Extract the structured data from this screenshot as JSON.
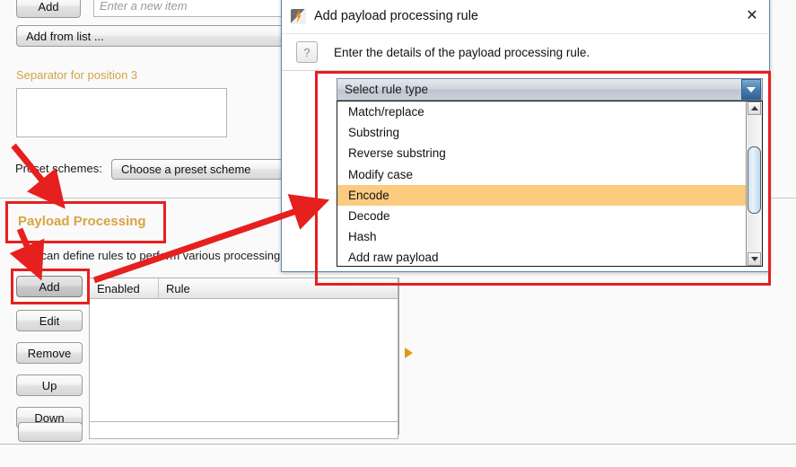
{
  "background": {
    "add_button": "Add",
    "new_item_placeholder": "Enter a new item",
    "add_from_list": "Add from list ...",
    "separator_label": "Separator for position 3",
    "separator_value": "",
    "preset_label": "Preset schemes:",
    "preset_value": "Choose a preset scheme",
    "payload_processing_title": "Payload Processing",
    "payload_processing_desc": "You can define rules to perform various processing",
    "buttons": [
      "Add",
      "Edit",
      "Remove",
      "Up",
      "Down"
    ],
    "table": {
      "columns": [
        "Enabled",
        "Rule"
      ],
      "rows": []
    },
    "bottom_button": "",
    "accent_heading_color": "#d9a441",
    "accent_label_color": "#d3a34a"
  },
  "dialog": {
    "title": "Add payload processing rule",
    "icon": "burp-bolt-icon",
    "close_label": "✕",
    "help_badge": "?",
    "instruction": "Enter the details of the payload processing rule.",
    "combo": {
      "selected": "Select rule type",
      "options": [
        "Match/replace",
        "Substring",
        "Reverse substring",
        "Modify case",
        "Encode",
        "Decode",
        "Hash",
        "Add raw payload"
      ],
      "highlighted": "Encode",
      "highlight_color": "#fbcc7f"
    }
  },
  "annotations": {
    "color": "#e5201f",
    "boxes": [
      "dropdown-list",
      "payload-processing-heading",
      "add-button"
    ],
    "arrows": [
      "arrow-to-payload-processing",
      "arrow-to-add-button",
      "arrow-add-to-dropdown"
    ]
  }
}
